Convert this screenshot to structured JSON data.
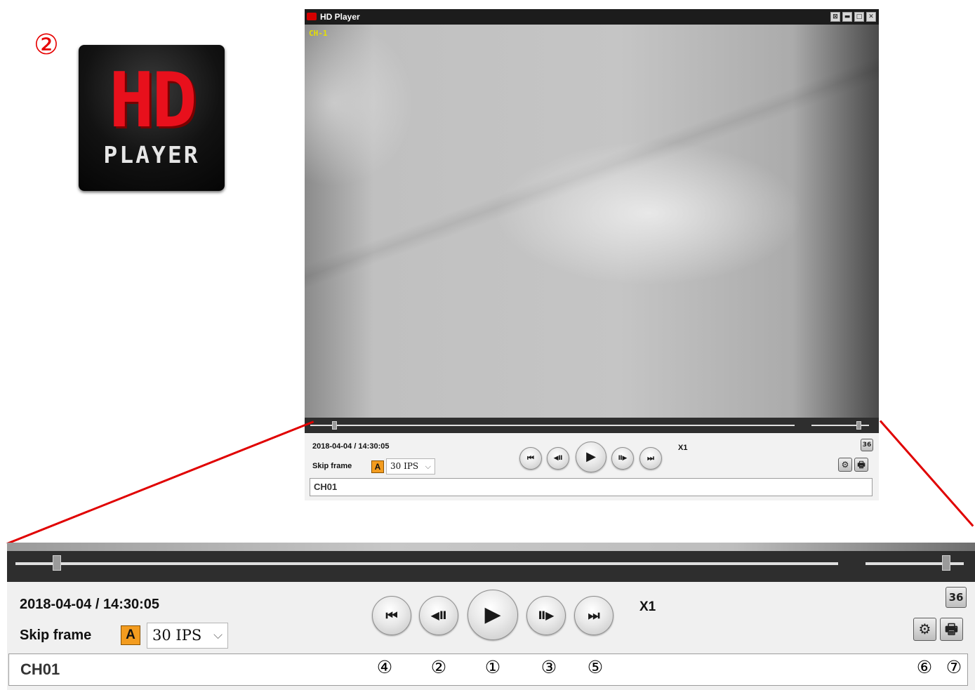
{
  "icon": {
    "number": "②",
    "logo_text": "HD",
    "logo_subtext": "PLAYER"
  },
  "window": {
    "title": "HD Player",
    "title_buttons": [
      "⊠",
      "▬",
      "□",
      "✕"
    ]
  },
  "video": {
    "channel_overlay": "CH-1"
  },
  "seek": {
    "position_fraction": 0.05,
    "volume_fraction": 0.82
  },
  "controls": {
    "datetime": "2018-04-04 / 14:30:05",
    "skip_label": "Skip frame",
    "auto_button": "A",
    "fps_value": "30 IPS",
    "speed": "X1",
    "split_button": "36",
    "channel_field": "CH01"
  },
  "playback_icons": {
    "first": "⏮",
    "step_back": "◀Ⅱ",
    "play": "▶",
    "step_forward": "Ⅱ▶",
    "last": "⏭",
    "settings": "⚙",
    "print": "🖶"
  },
  "zoom_labels": {
    "first": "④",
    "step_back": "②",
    "play": "①",
    "step_forward": "③",
    "last": "⑤",
    "settings": "⑥",
    "print": "⑦"
  }
}
